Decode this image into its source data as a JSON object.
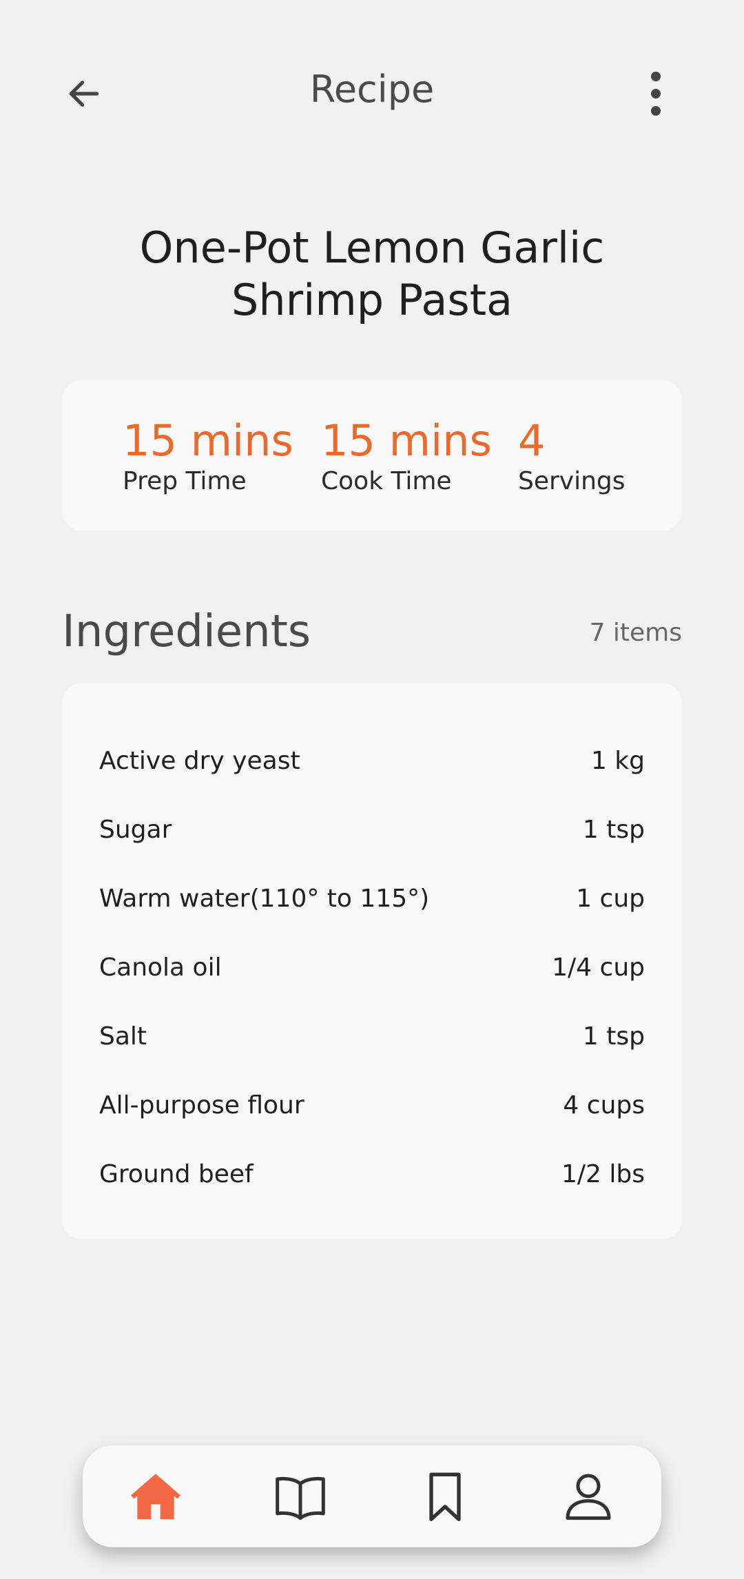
{
  "header": {
    "title": "Recipe",
    "back_icon": "arrow-left-icon",
    "more_icon": "more-vertical-icon"
  },
  "recipe": {
    "title": "One-Pot Lemon Garlic Shrimp Pasta"
  },
  "stats": [
    {
      "value": "15 mins",
      "label": "Prep Time"
    },
    {
      "value": "15 mins",
      "label": "Cook Time"
    },
    {
      "value": "4",
      "label": "Servings"
    }
  ],
  "ingredients": {
    "heading": "Ingredients",
    "count": "7 items",
    "items": [
      {
        "name": "Active dry yeast",
        "amount": "1 kg"
      },
      {
        "name": "Sugar",
        "amount": "1 tsp"
      },
      {
        "name": "Warm water(110° to 115°)",
        "amount": "1 cup"
      },
      {
        "name": "Canola oil",
        "amount": "1/4 cup"
      },
      {
        "name": "Salt",
        "amount": "1 tsp"
      },
      {
        "name": "All-purpose flour",
        "amount": "4 cups"
      },
      {
        "name": "Ground beef",
        "amount": "1/2 lbs"
      }
    ]
  },
  "bottom_nav": {
    "items": [
      {
        "icon": "home-icon",
        "active": true
      },
      {
        "icon": "book-icon",
        "active": false
      },
      {
        "icon": "bookmark-icon",
        "active": false
      },
      {
        "icon": "profile-icon",
        "active": false
      }
    ]
  },
  "colors": {
    "accent": "#ea6a2b",
    "active_nav": "#f26744",
    "icon": "#333333",
    "background": "#f1f1f1",
    "card": "#f8f8f8"
  }
}
